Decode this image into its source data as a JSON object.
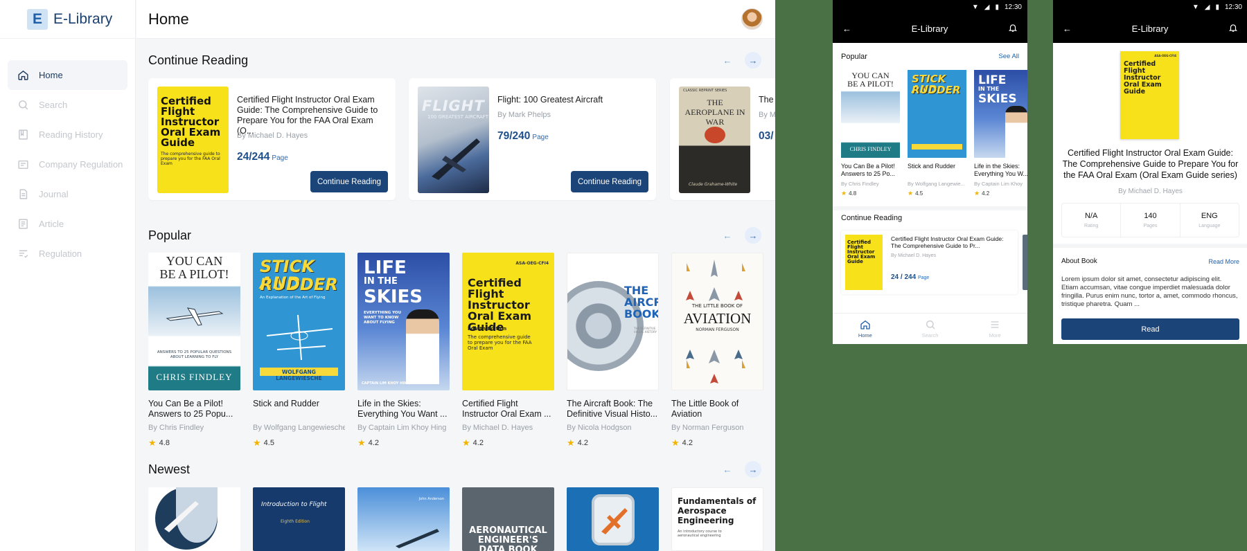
{
  "desktop": {
    "brand": {
      "logo_letter": "E",
      "name": "E-Library"
    },
    "nav": [
      {
        "label": "Home",
        "icon": "home-icon",
        "active": true
      },
      {
        "label": "Search",
        "icon": "search-icon"
      },
      {
        "label": "Reading History",
        "icon": "book-icon"
      },
      {
        "label": "Company Regulation",
        "icon": "document-icon"
      },
      {
        "label": "Journal",
        "icon": "journal-icon"
      },
      {
        "label": "Article",
        "icon": "article-icon"
      },
      {
        "label": "Regulation",
        "icon": "regulation-icon"
      }
    ],
    "page_title": "Home",
    "continue_reading": {
      "title": "Continue Reading",
      "items": [
        {
          "title": "Certified Flight Instructor Oral Exam Guide: The Comprehensive Guide to Prepare You for the FAA Oral Exam (O...",
          "author": "By Michael D. Hayes",
          "progress": "24/244",
          "unit": "Page",
          "button": "Continue Reading"
        },
        {
          "title": "Flight: 100 Greatest Aircraft",
          "author": "By Mark Phelps",
          "progress": "79/240",
          "unit": "Page",
          "button": "Continue Reading"
        },
        {
          "title": "The",
          "author": "By M",
          "progress": "03/",
          "unit": ""
        }
      ]
    },
    "popular": {
      "title": "Popular",
      "items": [
        {
          "title": "You Can Be a Pilot! Answers to 25 Popu...",
          "author": "By Chris Findley",
          "rating": "4.8"
        },
        {
          "title": "Stick and Rudder",
          "author": "By Wolfgang Langewiesche",
          "rating": "4.5"
        },
        {
          "title": "Life in the Skies: Everything You Want ...",
          "author": "By Captain Lim Khoy Hing",
          "rating": "4.2"
        },
        {
          "title": "Certified Flight Instructor Oral Exam ...",
          "author": "By Michael D. Hayes",
          "rating": "4.2"
        },
        {
          "title": "The Aircraft Book: The Definitive Visual Histo...",
          "author": "By Nicola Hodgson",
          "rating": "4.2"
        },
        {
          "title": "The Little Book of Aviation",
          "author": "By Norman Ferguson",
          "rating": "4.2"
        }
      ]
    },
    "newest": {
      "title": "Newest"
    },
    "covers": {
      "pilot": {
        "line1": "YOU CAN",
        "line2": "BE A PILOT!",
        "tag": "ANSWERS TO 25 POPULAR QUESTIONS ABOUT LEARNING TO FLY",
        "author": "CHRIS FINDLEY"
      },
      "stick": {
        "line1": "STICK AND",
        "line2": "RUDDER",
        "sub": "An Explanation of the Art of Flying",
        "author": "WOLFGANG LANGEWIESCHE"
      },
      "life": {
        "line1": "LIFE",
        "line2": "IN THE",
        "line3": "SKIES",
        "sub": "EVERYTHING YOU WANT TO KNOW ABOUT FLYING",
        "author": "CAPTAIN LIM KHOY HING"
      },
      "cfi": {
        "badge": "ASA-OEG-CFI4",
        "title": "Certified Flight Instructor Oral Exam Guide",
        "edition": "Fourth Edition",
        "desc": "The comprehensive guide to prepare you for the FAA Oral Exam"
      },
      "aircraft": {
        "title": "THE AIRCRAFT BOOK",
        "sub": "THE DEFINITIVE VISUAL HISTORY"
      },
      "aviation": {
        "small": "THE LITTLE BOOK OF",
        "title": "AVIATION",
        "author": "NORMAN FERGUSON"
      },
      "flight": {
        "title": "FLIGHT",
        "sub": "100 GREATEST AIRCRAFT"
      },
      "aeroplane": {
        "series": "CLASSIC REPRINT SERIES",
        "title": "THE AEROPLANE IN WAR",
        "author": "Claude Grahame-White"
      },
      "intro": {
        "title": "Introduction to Flight",
        "sub": "Eighth Edition"
      },
      "aero": {
        "title": "AERONAUTICAL ENGINEER'S DATA BOOK"
      },
      "fund": {
        "title": "Fundamentals of Aerospace Engineering",
        "sub": "An introductory course to aeronautical engineering"
      },
      "john": {
        "author": "John Anderson"
      }
    }
  },
  "phone1": {
    "time": "12:30",
    "title": "E-Library",
    "popular_label": "Popular",
    "see_all": "See All",
    "books": [
      {
        "title": "You Can Be a Pilot! Answers to 25 Po...",
        "author": "By Chris Findley",
        "rating": "4.8"
      },
      {
        "title": "Stick and Rudder",
        "author": "By Wolfgang Langewie...",
        "rating": "4.5"
      },
      {
        "title": "Life in the Skies: Everything You W...",
        "author": "By Captain Lim Khoy",
        "rating": "4.2"
      }
    ],
    "continue_label": "Continue Reading",
    "continue_item": {
      "title": "Certified Flight Instructor Oral Exam Guide: The Comprehensive Guide to Pr...",
      "author": "By Michael D. Hayes",
      "progress": "24 / 244",
      "unit": "Page"
    },
    "nav": [
      {
        "label": "Home"
      },
      {
        "label": "Search"
      },
      {
        "label": "More"
      }
    ]
  },
  "phone2": {
    "time": "12:30",
    "title": "E-Library",
    "book_title": "Certified Flight Instructor Oral Exam Guide: The Comprehensive Guide to Prepare You for the FAA Oral Exam (Oral Exam Guide series)",
    "author": "By Michael D. Hayes",
    "stats": [
      {
        "value": "N/A",
        "label": "Rating"
      },
      {
        "value": "140",
        "label": "Pages"
      },
      {
        "value": "ENG",
        "label": "Language"
      }
    ],
    "about_label": "About Book",
    "read_more": "Read More",
    "about_text": "Lorem ipsum dolor sit amet, consectetur adipiscing elit. Etiam accumsan, vitae congue imperdiet malesuada dolor fringilla. Purus enim nunc, tortor a, amet, commodo rhoncus, tristique pharetra. Quam ...",
    "read_button": "Read"
  }
}
